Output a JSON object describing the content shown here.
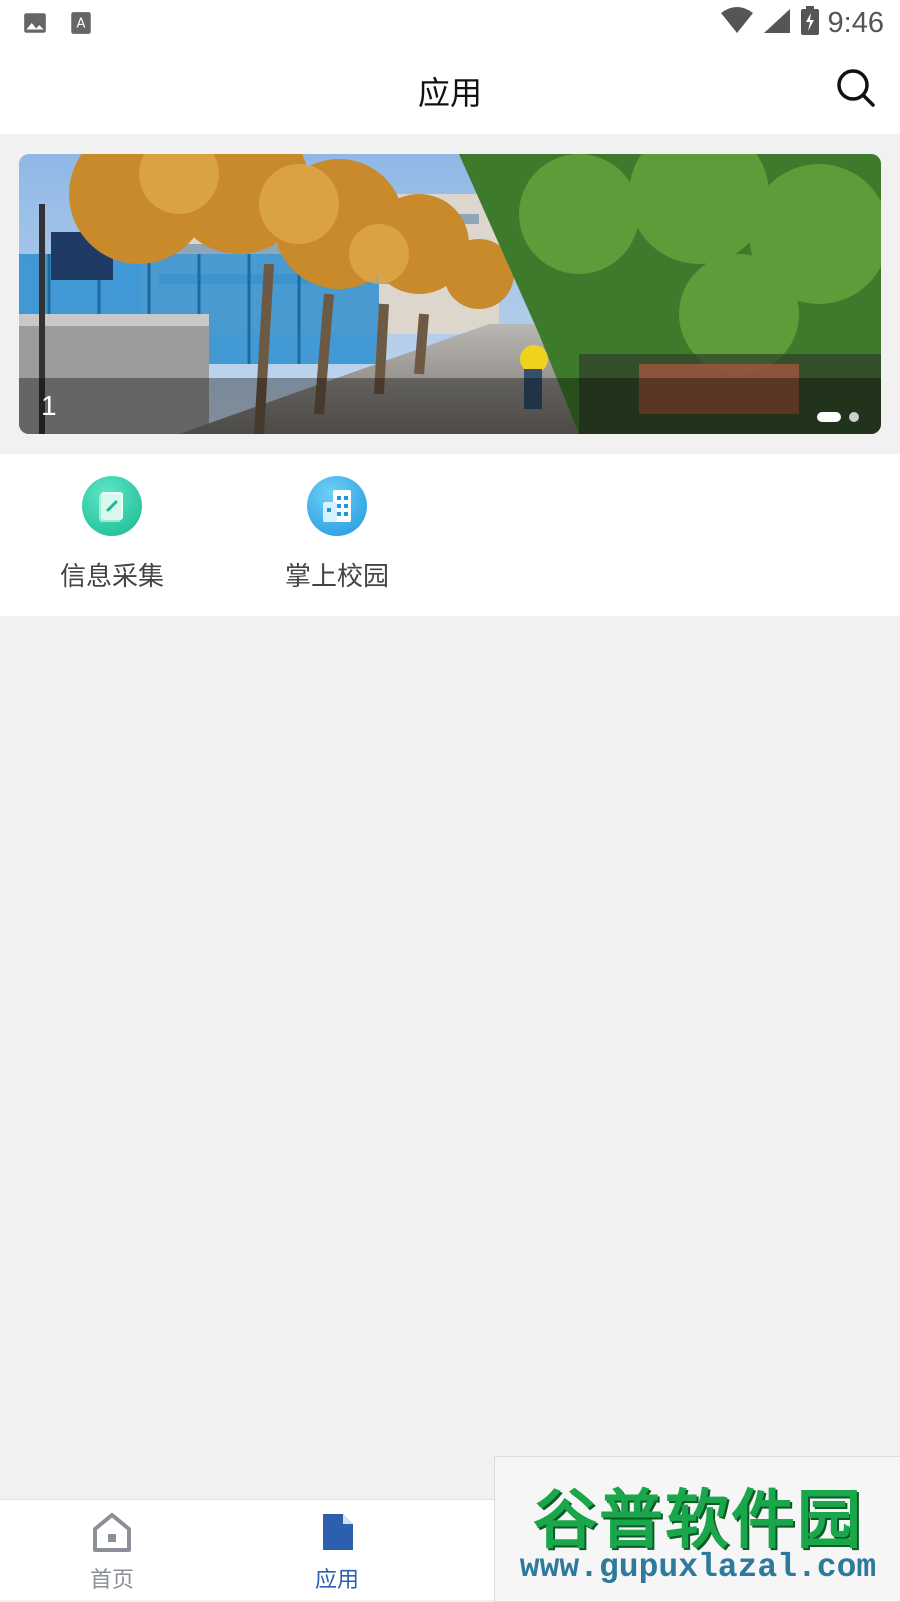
{
  "status_bar": {
    "time": "9:46",
    "left_icons": [
      "image-icon",
      "font-download-icon"
    ],
    "right_icons": [
      "wifi-icon",
      "signal-icon",
      "battery-charging-icon"
    ]
  },
  "header": {
    "title": "应用",
    "search_icon": "search-icon"
  },
  "banner": {
    "index_label": "1",
    "slide_count": 2,
    "active_slide": 1,
    "image_description": "campus road with autumn trees and evergreen trees"
  },
  "apps": [
    {
      "label": "信息采集",
      "icon": "edit-document-icon",
      "color": "#1fc8a2"
    },
    {
      "label": "掌上校园",
      "icon": "buildings-icon",
      "color": "#27a7e7"
    }
  ],
  "bottom_nav": {
    "items": [
      {
        "label": "首页",
        "icon": "home-icon",
        "active": false
      },
      {
        "label": "应用",
        "icon": "document-icon",
        "active": true
      }
    ],
    "active_color": "#2c5fae",
    "inactive_color": "#8a8f99"
  },
  "watermark": {
    "title": "谷普软件园",
    "url": "www.gupuxlazal.com"
  }
}
